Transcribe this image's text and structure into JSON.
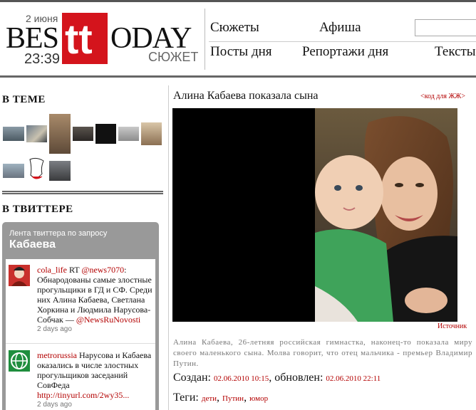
{
  "header": {
    "logo_left": "BES",
    "logo_tt": "tt",
    "logo_right": "ODAY",
    "date": "2 июня",
    "time": "23:39",
    "section": "СЮЖЕТ",
    "nav_row1": [
      "Сюжеты",
      "Афиша"
    ],
    "nav_row2": [
      "Посты дня",
      "Репортажи дня",
      "Тексты"
    ],
    "search_placeholder": ""
  },
  "sidebar": {
    "theme_heading": "В ТЕМЕ",
    "twitter_heading": "В ТВИТТЕРЕ",
    "twitter_widget": {
      "feed_label": "Лента твиттера по запросу",
      "query": "Кабаева",
      "tweets": [
        {
          "user": "cola_life",
          "text": " RT ",
          "mention": "@news7070",
          "body": ": Обнародованы самые злостные прогульщики в ГД и СФ. Среди них Алина Кабаева, Светлана Хоркина и Людмила Нарусова-Собчак — ",
          "link": "@NewsRuNovosti",
          "ago": "2 days ago"
        },
        {
          "user": "metrorussia",
          "body": " Нарусова и Кабаева оказались в числе злостных прогульщиков заседаний СовФеда ",
          "link": "http://tinyurl.com/2wy35...",
          "ago": "2 days ago"
        }
      ]
    }
  },
  "article": {
    "title": "Алина Кабаева показала сына",
    "embed_link": "<код для ЖЖ>",
    "source_link": "Источник",
    "caption": "Алина Кабаева, 26-летняя российская гимнастка, наконец-то показала миру своего маленького сына. Молва говорит, что отец мальчика - премьер Владимир Путин.",
    "created_label": "Создан: ",
    "created_value": "02.06.2010 10:15",
    "updated_label": ", обновлен: ",
    "updated_value": "02.06.2010 22:11",
    "tags_label": "Теги: ",
    "tags": [
      "дети",
      "Путин",
      "юмор"
    ]
  },
  "colors": {
    "brand_red": "#d4141c",
    "link_red": "#b30000"
  }
}
